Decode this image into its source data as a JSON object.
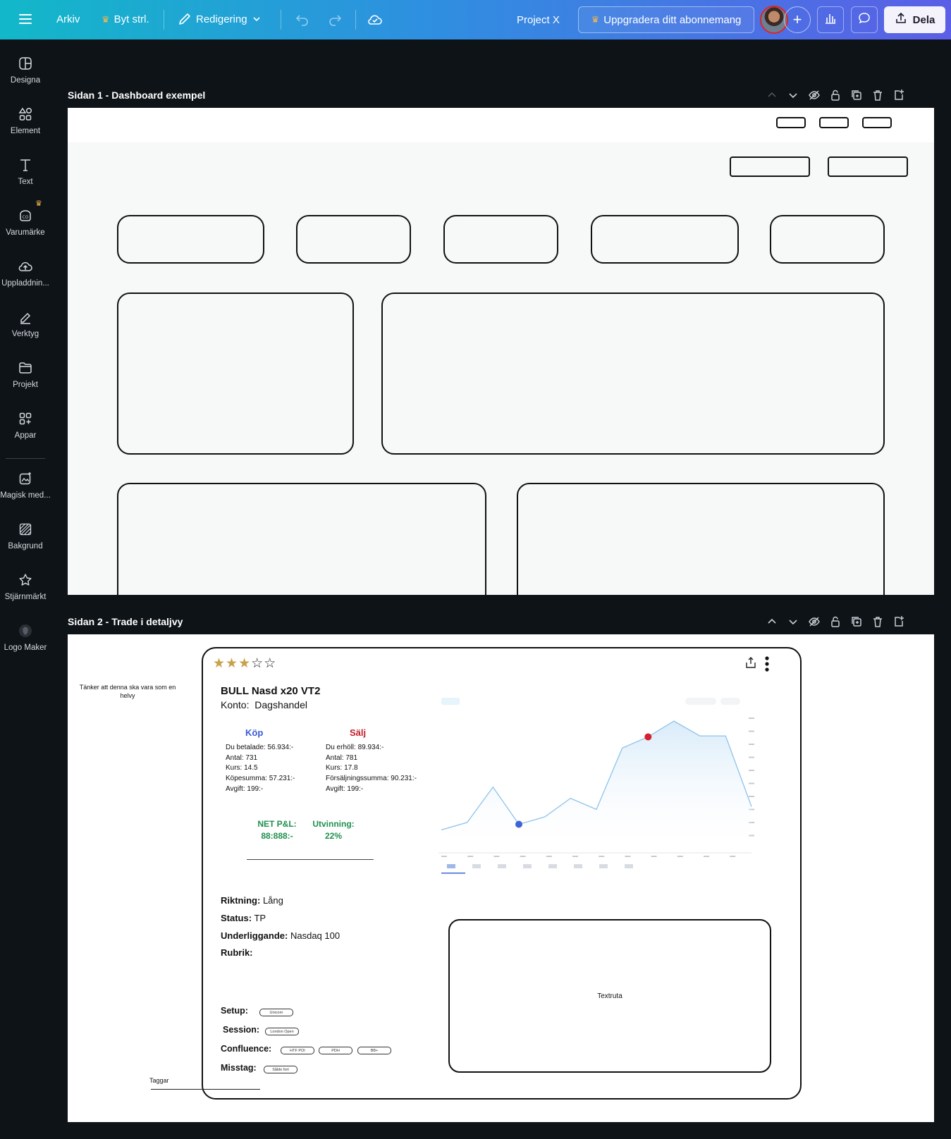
{
  "topbar": {
    "menu_icon": "hamburger-icon",
    "arkiv": "Arkiv",
    "resize": "Byt strl.",
    "editing": "Redigering",
    "project_name": "Project X",
    "upgrade": "Uppgradera ditt abonnemang",
    "share": "Dela",
    "plus": "+",
    "crown_color": "#f5b84d"
  },
  "sidebar": {
    "items": [
      {
        "label": "Designa",
        "icon": "layout-icon"
      },
      {
        "label": "Element",
        "icon": "shapes-icon"
      },
      {
        "label": "Text",
        "icon": "text-icon"
      },
      {
        "label": "Varumärke",
        "icon": "brand-icon"
      },
      {
        "label": "Uppladdnin...",
        "icon": "upload-cloud-icon"
      },
      {
        "label": "Verktyg",
        "icon": "pen-tool-icon"
      },
      {
        "label": "Projekt",
        "icon": "folder-icon"
      },
      {
        "label": "Appar",
        "icon": "apps-icon"
      },
      {
        "label": "Magisk med...",
        "icon": "magic-media-icon"
      },
      {
        "label": "Bakgrund",
        "icon": "background-icon"
      },
      {
        "label": "Stjärnmärkt",
        "icon": "star-icon"
      },
      {
        "label": "Logo Maker",
        "icon": "logo-maker-icon"
      }
    ]
  },
  "pages": {
    "page1_title": "Sidan 1 - Dashboard exempel",
    "page2_title": "Sidan 2 - Trade i detaljvy"
  },
  "trade": {
    "note": "Tänker att denna ska vara som en helvy",
    "rating": 3,
    "rating_max": 5,
    "title": "BULL Nasd x20 VT2",
    "account_label": "Konto:",
    "account_value": "Dagshandel",
    "buy": {
      "heading": "Köp",
      "color": "#3b5bd6",
      "lines": [
        "Du betalade: 56.934:-",
        "Antal: 731",
        "Kurs: 14.5",
        "Köpesumma: 57.231:-",
        "Avgift: 199:-"
      ]
    },
    "sell": {
      "heading": "Sälj",
      "color": "#c0202a",
      "lines": [
        "Du erhöll: 89.934:-",
        "Antal: 781",
        "Kurs: 17.8",
        "Försäljningssumma: 90.231:-",
        "Avgift: 199:-"
      ]
    },
    "net_label": "NET P&L:",
    "net_value": "88:888:-",
    "yield_label": "Utvinning:",
    "yield_value": "22%",
    "green": "#1f8f4e",
    "direction_label": "Riktning:",
    "direction_value": "Lång",
    "status_label": "Status:",
    "status_value": "TP",
    "underlying_label": "Underliggande:",
    "underlying_value": "Nasdaq 100",
    "heading_label": "Rubrik:",
    "setup_label": "Setup:",
    "setup_tags": [
      "Unicorn"
    ],
    "session_label": "Session:",
    "session_tags": [
      "London Open"
    ],
    "confluence_label": "Confluence:",
    "confluence_tags": [
      "HTF POI",
      "PDH",
      "BB+"
    ],
    "mistake_label": "Misstag:",
    "mistake_tags": [
      "Sålde fort"
    ],
    "tags_caption": "Taggar",
    "textbox_label": "Textruta"
  },
  "chart_data": {
    "type": "area",
    "values": [
      0.8,
      1.6,
      5.4,
      1.4,
      2.2,
      4.2,
      3.0,
      9.6,
      10.8,
      12.5,
      10.9,
      10.9,
      3.3
    ],
    "entry_marker_index": 3,
    "exit_marker_index": 8,
    "line_color": "#8ec3ea",
    "entry_color": "#3d63d8",
    "exit_color": "#d6202c"
  }
}
